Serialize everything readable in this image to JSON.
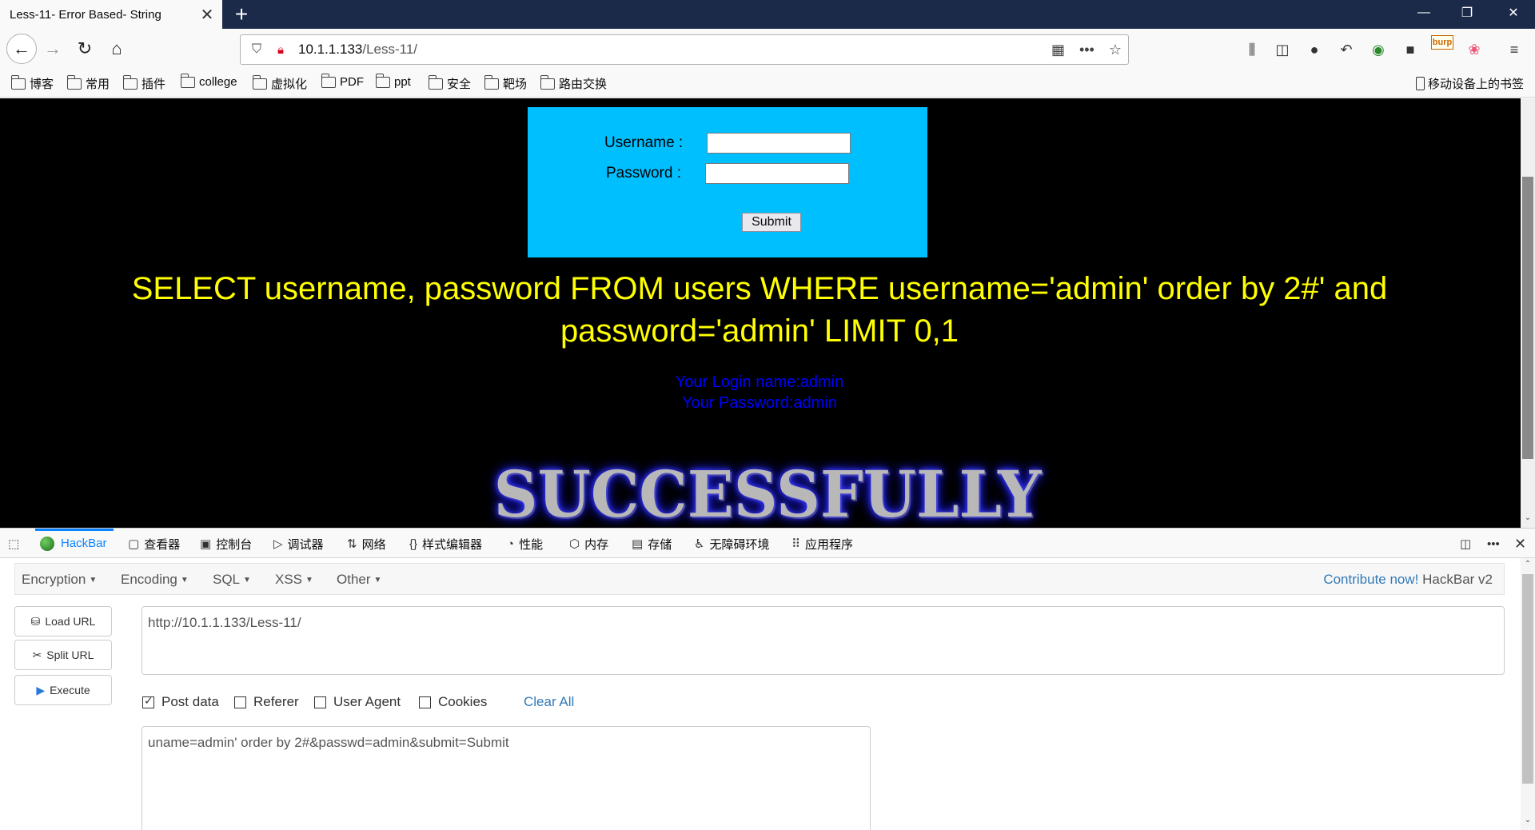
{
  "browser": {
    "tab_title": "Less-11- Error Based- String",
    "url_host": "10.1.1.133",
    "url_path": "/Less-11/",
    "bookmarks": [
      "博客",
      "常用",
      "插件",
      "college",
      "虚拟化",
      "PDF",
      "ppt",
      "安全",
      "靶场",
      "路由交换"
    ],
    "mobile_bookmarks": "移动设备上的书签",
    "burp_label": "burp"
  },
  "page": {
    "username_label": "Username :",
    "password_label": "Password :",
    "submit_label": "Submit",
    "query_line1": "SELECT username, password FROM users WHERE username='admin' order by 2#' and",
    "query_line2": "password='admin' LIMIT 0,1",
    "login_name": "Your Login name:admin",
    "login_password": "Your Password:admin",
    "success_text": "SUCCESSFULLY"
  },
  "devtools": {
    "tabs": [
      "HackBar",
      "查看器",
      "控制台",
      "调试器",
      "网络",
      "样式编辑器",
      "性能",
      "内存",
      "存储",
      "无障碍环境",
      "应用程序"
    ],
    "active_tab": "HackBar"
  },
  "hackbar": {
    "menus": [
      "Encryption",
      "Encoding",
      "SQL",
      "XSS",
      "Other"
    ],
    "contribute_link": "Contribute now!",
    "version": "HackBar v2",
    "buttons": [
      "Load URL",
      "Split URL",
      "Execute"
    ],
    "url_value": "http://10.1.1.133/Less-11/",
    "options": [
      {
        "label": "Post data",
        "checked": true
      },
      {
        "label": "Referer",
        "checked": false
      },
      {
        "label": "User Agent",
        "checked": false
      },
      {
        "label": "Cookies",
        "checked": false
      }
    ],
    "clear_all": "Clear All",
    "post_value": "uname=admin' order by 2#&passwd=admin&submit=Submit"
  }
}
